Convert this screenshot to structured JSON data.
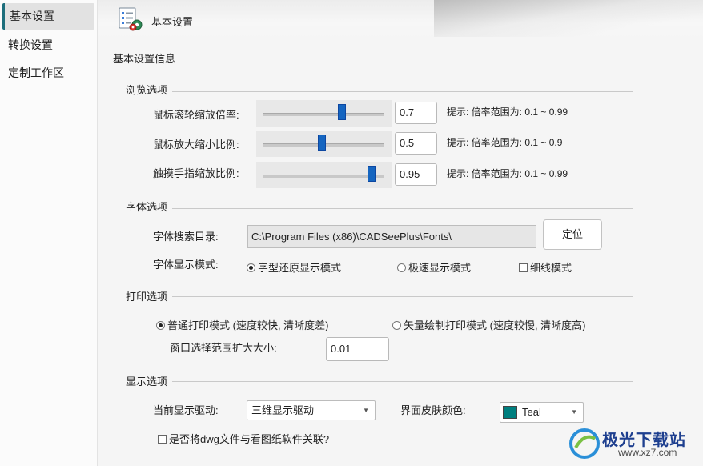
{
  "sidebar": {
    "items": [
      {
        "label": "基本设置",
        "active": true
      },
      {
        "label": "转换设置",
        "active": false
      },
      {
        "label": "定制工作区",
        "active": false
      }
    ]
  },
  "header": {
    "title": "基本设置",
    "icon": "settings-document-icon"
  },
  "main": {
    "info_title": "基本设置信息",
    "browse": {
      "title": "浏览选项",
      "rows": [
        {
          "label": "鼠标滚轮缩放倍率:",
          "slider_fraction": 0.66,
          "value": "0.7",
          "hint": "提示: 倍率范围为: 0.1 ~ 0.99"
        },
        {
          "label": "鼠标放大缩小比例:",
          "slider_fraction": 0.48,
          "value": "0.5",
          "hint": "提示: 倍率范围为: 0.1 ~ 0.9"
        },
        {
          "label": "触摸手指缩放比例:",
          "slider_fraction": 0.92,
          "value": "0.95",
          "hint": "提示: 倍率范围为: 0.1 ~ 0.99"
        }
      ]
    },
    "font": {
      "title": "字体选项",
      "dir_label": "字体搜索目录:",
      "dir_value": "C:\\Program Files (x86)\\CADSeePlus\\Fonts\\",
      "locate_button": "定位",
      "mode_label": "字体显示模式:",
      "mode_options": [
        {
          "label": "字型还原显示模式",
          "selected": true
        },
        {
          "label": "极速显示模式",
          "selected": false
        }
      ],
      "thin_line_label": "细线模式",
      "thin_line_checked": false
    },
    "print": {
      "title": "打印选项",
      "options": [
        {
          "label": "普通打印模式 (速度较快, 清晰度差)",
          "selected": true
        },
        {
          "label": "矢量绘制打印模式 (速度较慢, 清晰度高)",
          "selected": false
        }
      ],
      "expand_label": "窗口选择范围扩大大小:",
      "expand_value": "0.01"
    },
    "display": {
      "title": "显示选项",
      "driver_label": "当前显示驱动:",
      "driver_value": "三维显示驱动",
      "skin_label": "界面皮肤颜色:",
      "skin_value": "Teal",
      "skin_color": "#008080",
      "assoc_label": "是否将dwg文件与看图纸软件关联?",
      "assoc_checked": false
    }
  },
  "watermark": {
    "text": "极光下载站",
    "url_text": "www.xz7.com"
  }
}
